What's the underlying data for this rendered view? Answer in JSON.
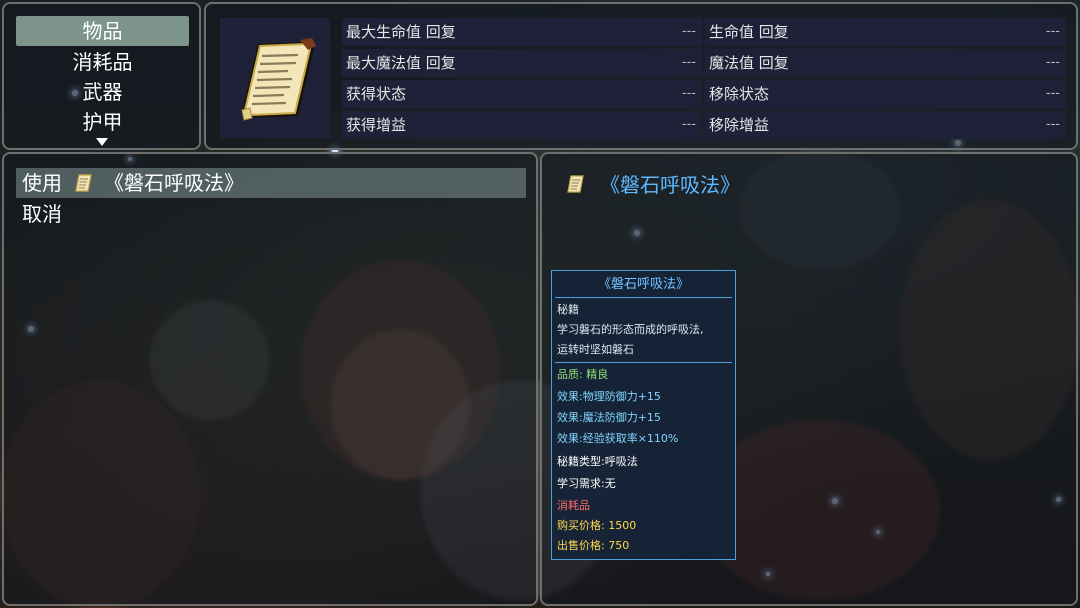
{
  "categories": {
    "items": [
      "物品",
      "消耗品",
      "武器",
      "护甲"
    ],
    "selected_index": 0
  },
  "stats": {
    "left": [
      {
        "label": "最大生命值 回复",
        "value": "---"
      },
      {
        "label": "最大魔法值 回复",
        "value": "---"
      },
      {
        "label": "获得状态",
        "value": "---"
      },
      {
        "label": "获得增益",
        "value": "---"
      }
    ],
    "right": [
      {
        "label": "生命值 回复",
        "value": "---"
      },
      {
        "label": "魔法值 回复",
        "value": "---"
      },
      {
        "label": "移除状态",
        "value": "---"
      },
      {
        "label": "移除增益",
        "value": "---"
      }
    ]
  },
  "command": {
    "use_label": "使用",
    "item_name": "《磐石呼吸法》",
    "cancel_label": "取消"
  },
  "detail": {
    "title": "《磐石呼吸法》",
    "tooltip": {
      "title": "《磐石呼吸法》",
      "category": "秘籍",
      "desc1": "学习磐石的形态而成的呼吸法,",
      "desc2": "运转时坚如磐石",
      "quality": "品质: 精良",
      "effect1": "效果:物理防御力+15",
      "effect2": "效果:魔法防御力+15",
      "effect3": "效果:经验获取率×110%",
      "type": "秘籍类型:呼吸法",
      "requirement": "学习需求:无",
      "kind": "消耗品",
      "buy": "购买价格: 1500",
      "sell": "出售价格: 750"
    }
  },
  "colors": {
    "accent_blue": "#5fb8ff",
    "tooltip_border": "#4ea0d8",
    "effect_cyan": "#7fd6ff",
    "quality_green": "#8ee07a",
    "kind_red": "#ff6b6b",
    "price_yellow": "#ffd84a"
  },
  "icons": {
    "item_icon": "scroll-icon"
  }
}
